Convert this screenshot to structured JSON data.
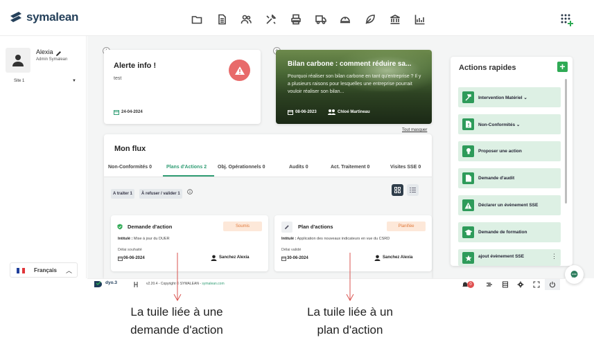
{
  "app": {
    "name": "symalean"
  },
  "nav": {
    "icons": [
      "folder-icon",
      "document-icon",
      "users-icon",
      "tools-icon",
      "printer-icon",
      "truck-icon",
      "helmet-icon",
      "leaf-icon",
      "bank-icon",
      "chart-icon"
    ]
  },
  "sidebar": {
    "user_name": "Alexia",
    "user_role": "Admin Symalean",
    "site": "Site 1",
    "language": "Français"
  },
  "alert": {
    "title": "Alerte info !",
    "text": "test",
    "date": "24-04-2024"
  },
  "bilan": {
    "title": "Bilan carbone : comment réduire sa...",
    "text": "Pourquoi réaliser son bilan carbone en tant qu'entreprise ? Il y a plusieurs raisons pour lesquelles une entreprise pourrait vouloir réaliser son bilan...",
    "date": "08-06-2023",
    "author": "Chloé Martineau"
  },
  "hide_all": "Tout masquer",
  "flux": {
    "title": "Mon flux",
    "tabs": [
      {
        "label": "Non-Conformités",
        "count": "0"
      },
      {
        "label": "Plans d'Actions",
        "count": "2"
      },
      {
        "label": "Obj. Opérationnels",
        "count": "0"
      },
      {
        "label": "Audits",
        "count": "0"
      },
      {
        "label": "Act. Traitement",
        "count": "0"
      },
      {
        "label": "Visites SSE",
        "count": "0"
      }
    ],
    "chips": [
      {
        "label": "A traiter",
        "count": "1"
      },
      {
        "label": "À refuser / valider",
        "count": "1"
      }
    ],
    "tiles": [
      {
        "title": "Demande d'action",
        "status": "Soumis",
        "intitule_label": "Intitulé :",
        "intitule": "Mise à jour du DUER",
        "delai_label": "Délai souhaité",
        "date": "06-06-2024",
        "person": "Sanchez Alexia"
      },
      {
        "title": "Plan d'actions",
        "status": "Planifiée",
        "intitule_label": "Intitulé :",
        "intitule": "Application des nouveaux indicateurs en vue du CSRD",
        "delai_label": "Délai validé",
        "date": "30-06-2024",
        "person": "Sanchez Alexia"
      }
    ]
  },
  "actions": {
    "title": "Actions rapides",
    "items": [
      {
        "label": "Intervention Matériel",
        "icon": "hammer-icon"
      },
      {
        "label": "Non-Conformités",
        "icon": "file-alert-icon"
      },
      {
        "label": "Proposer une action",
        "icon": "lightbulb-icon"
      },
      {
        "label": "Demande d'audit",
        "icon": "file-icon"
      },
      {
        "label": "Déclarer un évènement SSE",
        "icon": "warning-icon"
      },
      {
        "label": "Demande de formation",
        "icon": "graduation-icon"
      },
      {
        "label": "ajout évènement SSE",
        "icon": "star-icon"
      }
    ]
  },
  "footer": {
    "logo": "dyo.3",
    "copyright": "v2.20.4 - Copyright © SYMALEAN - ",
    "link": "symalean.com",
    "notif_count": "0"
  },
  "annotations": {
    "left": [
      "La tuile liée à une",
      "demande d'action"
    ],
    "right": [
      "La tuile liée à un",
      "plan d'action"
    ]
  },
  "colors": {
    "accent": "#2f9c73",
    "alert": "#e86a6a",
    "action_bg": "#ddf0e4",
    "status_bg": "#fde8d9",
    "annotation_arrow": "#d9534f"
  }
}
